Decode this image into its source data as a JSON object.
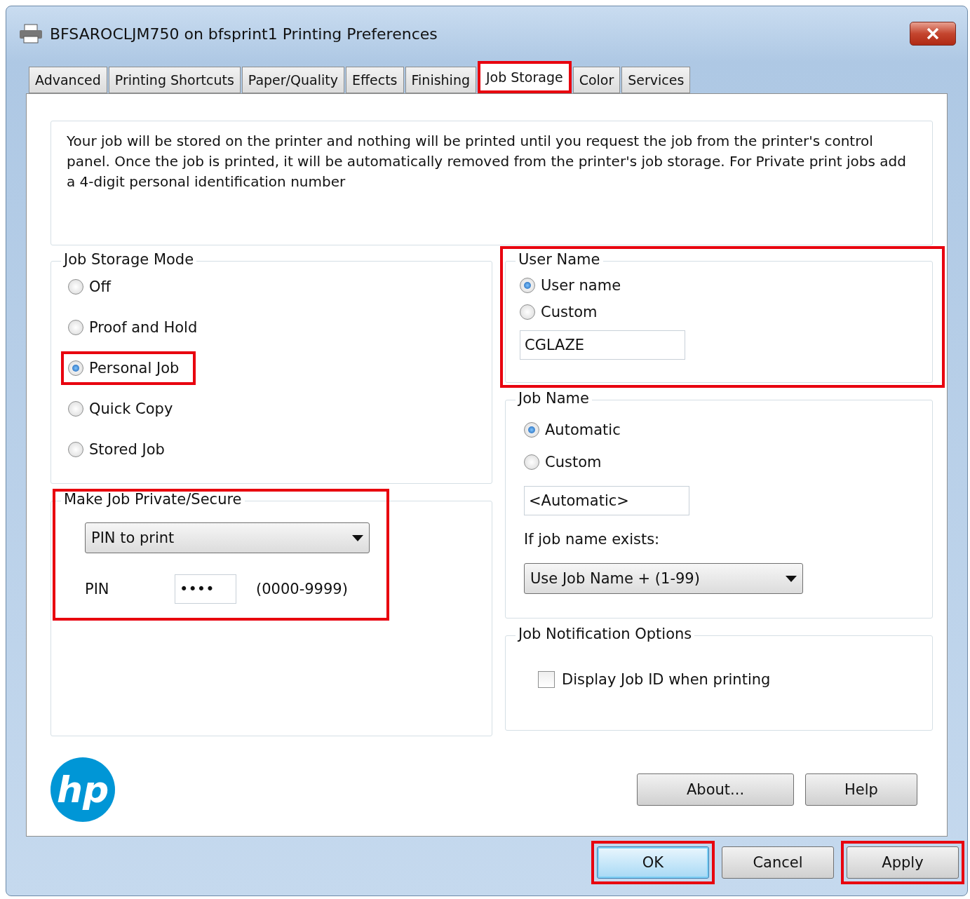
{
  "window": {
    "title": "BFSAROCLJM750 on bfsprint1 Printing Preferences"
  },
  "tabs": [
    {
      "label": "Advanced",
      "selected": false,
      "highlighted": false
    },
    {
      "label": "Printing Shortcuts",
      "selected": false,
      "highlighted": false
    },
    {
      "label": "Paper/Quality",
      "selected": false,
      "highlighted": false
    },
    {
      "label": "Effects",
      "selected": false,
      "highlighted": false
    },
    {
      "label": "Finishing",
      "selected": false,
      "highlighted": false
    },
    {
      "label": "Job Storage",
      "selected": true,
      "highlighted": true
    },
    {
      "label": "Color",
      "selected": false,
      "highlighted": false
    },
    {
      "label": "Services",
      "selected": false,
      "highlighted": false
    }
  ],
  "description": "Your job will be stored on the printer and nothing will be printed until you request the job from the printer's control panel.  Once the job is printed, it will be automatically removed from the printer's job storage.  For Private print jobs add a 4-digit personal identification number",
  "job_storage_mode": {
    "title": "Job Storage Mode",
    "options": [
      {
        "label": "Off",
        "selected": false,
        "highlighted": false
      },
      {
        "label": "Proof and Hold",
        "selected": false,
        "highlighted": false
      },
      {
        "label": "Personal Job",
        "selected": true,
        "highlighted": true
      },
      {
        "label": "Quick Copy",
        "selected": false,
        "highlighted": false
      },
      {
        "label": "Stored Job",
        "selected": false,
        "highlighted": false
      }
    ]
  },
  "private_secure": {
    "title": "Make Job Private/Secure",
    "highlighted": true,
    "dropdown": "PIN to print",
    "pin_label": "PIN",
    "pin_value": "••••",
    "pin_hint": "(0000-9999)"
  },
  "user_name": {
    "title": "User Name",
    "highlighted": true,
    "options": [
      {
        "label": "User name",
        "selected": true
      },
      {
        "label": "Custom",
        "selected": false
      }
    ],
    "value": "CGLAZE"
  },
  "job_name": {
    "title": "Job Name",
    "options": [
      {
        "label": "Automatic",
        "selected": true
      },
      {
        "label": "Custom",
        "selected": false
      }
    ],
    "value": "<Automatic>",
    "exists_label": "If job name exists:",
    "exists_dropdown": "Use Job Name + (1-99)"
  },
  "notification": {
    "title": "Job Notification Options",
    "checkbox": {
      "label": "Display Job ID when printing",
      "checked": false
    }
  },
  "logo": "hp",
  "buttons": [
    {
      "label": "About..."
    },
    {
      "label": "Help"
    }
  ],
  "dialog_buttons": [
    {
      "label": "OK",
      "highlighted": true,
      "default": true
    },
    {
      "label": "Cancel",
      "highlighted": false,
      "default": false
    },
    {
      "label": "Apply",
      "highlighted": true,
      "default": false
    }
  ]
}
